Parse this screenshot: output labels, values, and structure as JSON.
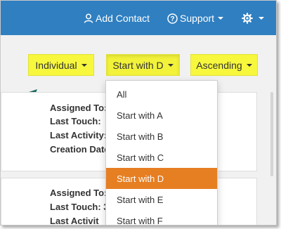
{
  "header": {
    "add_contact_label": "Add Contact",
    "support_label": "Support",
    "bar_color": "#2f7fc1"
  },
  "filters": {
    "type_label": "Individual",
    "letter_label": "Start with D",
    "order_label": "Ascending",
    "highlight_color": "#f7f73d"
  },
  "contact_cards": [
    {
      "assigned_to_label": "Assigned To:",
      "last_touch_label": "Last Touch:",
      "last_activity_label": "Last Activity:",
      "creation_date_label": "Creation Date"
    },
    {
      "assigned_to_label": "Assigned To:",
      "last_touch_label": "Last Touch: 3",
      "last_activity_label": "Last Activit"
    }
  ],
  "letter_menu": {
    "items": [
      "All",
      "Start with A",
      "Start with B",
      "Start with C",
      "Start with D",
      "Start with E",
      "Start with F"
    ],
    "selected": "Start with D",
    "active_color": "#e67e22"
  },
  "annotation": {
    "arrow_icon": "pointer-arrow-icon",
    "arrow_color": "#1b6b5f"
  }
}
